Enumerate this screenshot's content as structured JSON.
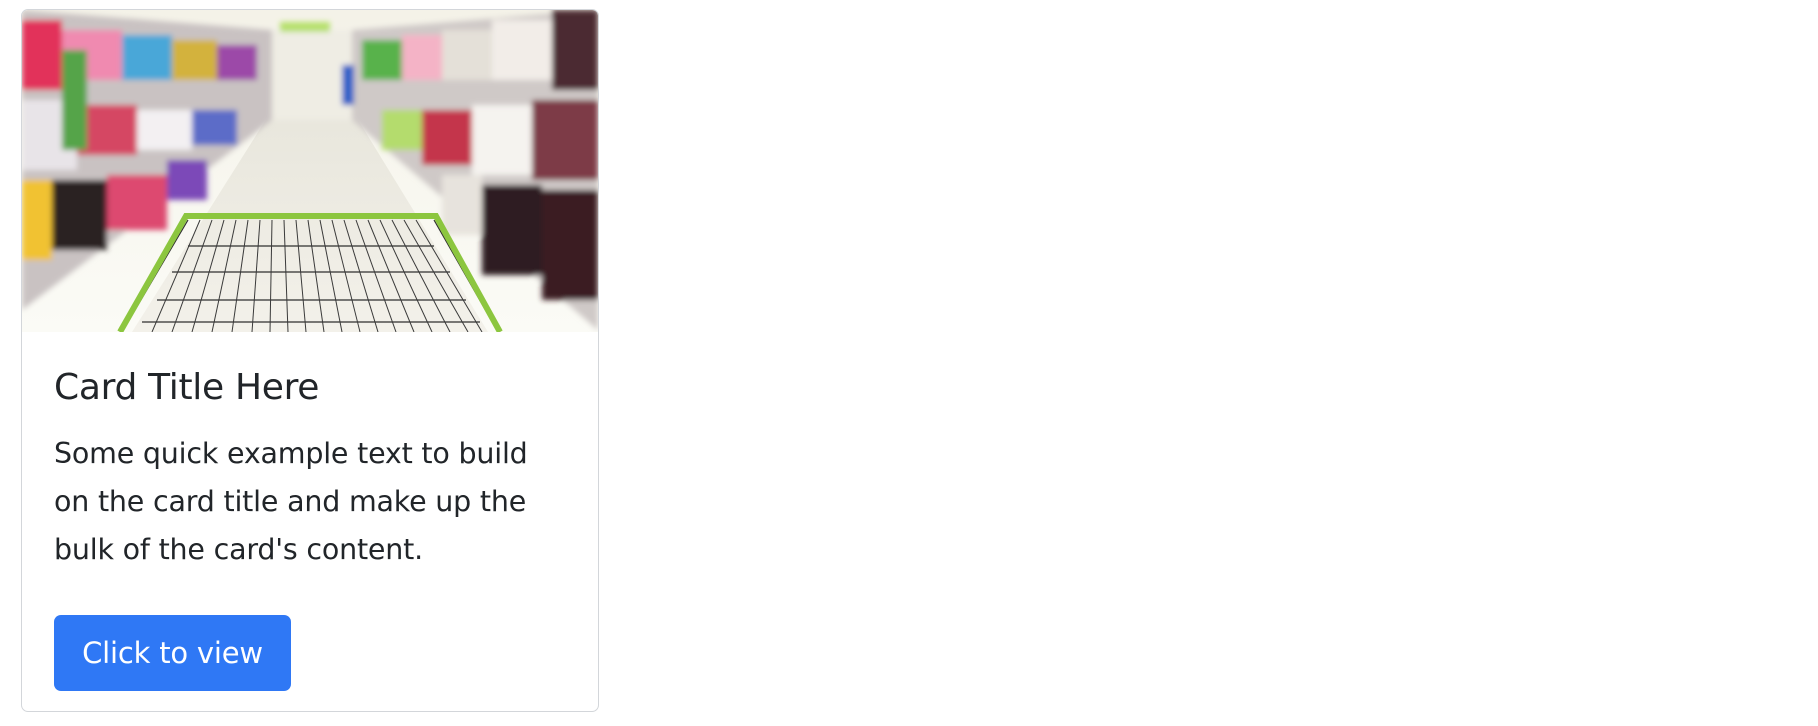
{
  "card": {
    "image_alt": "shopping cart in supermarket aisle",
    "title": "Card Title Here",
    "text": "Some quick example text to build on the card title and make up the bulk of the card's content.",
    "button_label": "Click to view"
  },
  "colors": {
    "button_bg": "#2f78f5",
    "text": "#212529",
    "border": "#d3d6da"
  }
}
